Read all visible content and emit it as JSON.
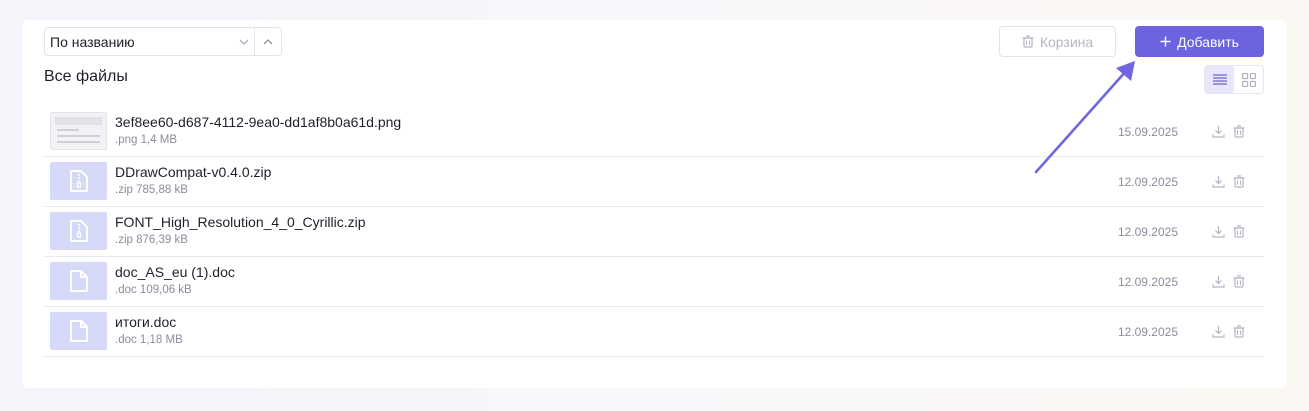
{
  "toolbar": {
    "sort_value": "По названию",
    "trash_label": "Корзина",
    "add_label": "Добавить"
  },
  "section_title": "Все файлы",
  "files": [
    {
      "name": "3ef8ee60-d687-4112-9ea0-dd1af8b0a61d.png",
      "meta": ".png 1,4 MB",
      "date": "15.09.2025",
      "thumb": "image-preview"
    },
    {
      "name": "DDrawCompat-v0.4.0.zip",
      "meta": ".zip 785,88 kB",
      "date": "12.09.2025",
      "thumb": "zip-file-icon"
    },
    {
      "name": "FONT_High_Resolution_4_0_Cyrillic.zip",
      "meta": ".zip 876,39 kB",
      "date": "12.09.2025",
      "thumb": "zip-file-icon"
    },
    {
      "name": "doc_AS_eu (1).doc",
      "meta": ".doc 109,06 kB",
      "date": "12.09.2025",
      "thumb": "document-file-icon"
    },
    {
      "name": "итоги.doc",
      "meta": ".doc 1,18 MB",
      "date": "12.09.2025",
      "thumb": "document-file-icon"
    }
  ],
  "colors": {
    "accent": "#6c63de",
    "thumb_bg": "#d6d9f7",
    "annotation_arrow": "#6f67e0"
  }
}
